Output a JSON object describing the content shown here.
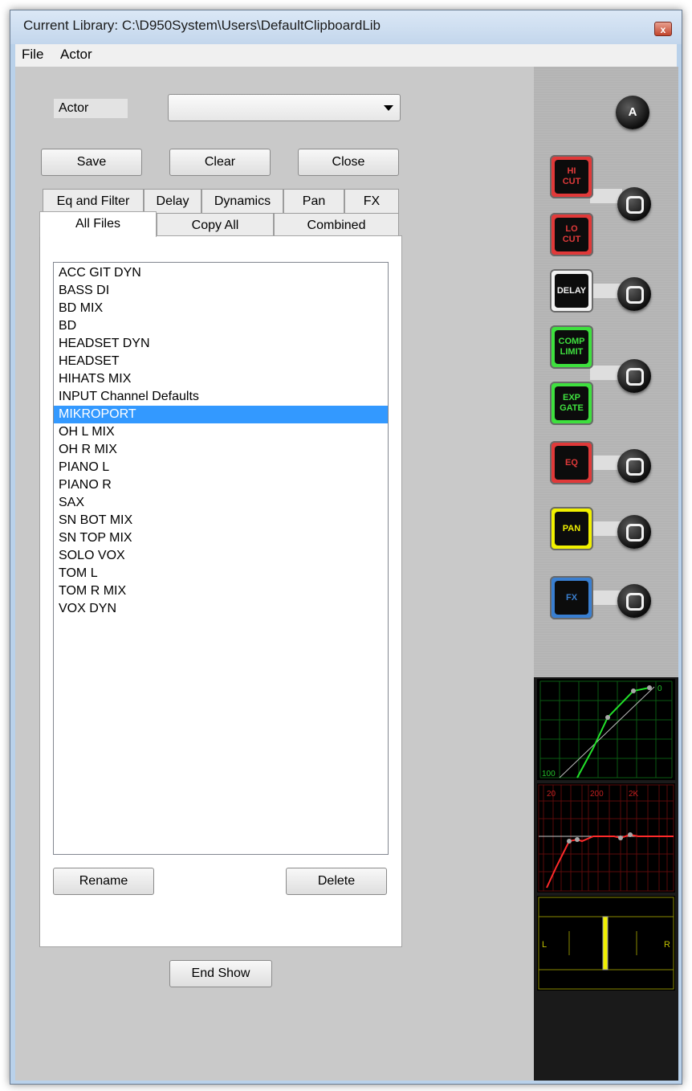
{
  "window": {
    "title": "Current Library: C:\\D950System\\Users\\DefaultClipboardLib",
    "close_glyph": "x"
  },
  "menu": [
    "File",
    "Actor"
  ],
  "actor": {
    "label": "Actor",
    "selected": ""
  },
  "buttons": {
    "save": "Save",
    "clear": "Clear",
    "close": "Close",
    "rename": "Rename",
    "delete": "Delete",
    "end_show": "End Show"
  },
  "tabs": {
    "top": [
      "Eq and Filter",
      "Delay",
      "Dynamics",
      "Pan",
      "FX"
    ],
    "bottom": [
      "All Files",
      "Copy All",
      "Combined"
    ],
    "active": "All Files"
  },
  "files": [
    "ACC GIT DYN",
    "BASS DI",
    "BD MIX",
    "BD",
    "HEADSET DYN",
    "HEADSET",
    "HIHATS MIX",
    "INPUT Channel Defaults",
    "MIKROPORT",
    "OH L MIX",
    "OH R MIX",
    "PIANO L",
    "PIANO R",
    "SAX",
    "SN BOT MIX",
    "SN TOP MIX",
    "SOLO VOX",
    "TOM L",
    "TOM R MIX",
    "VOX DYN"
  ],
  "selected_file": "MIKROPORT",
  "side_panel": {
    "a_knob": "A",
    "pads": [
      {
        "label": "HI\nCUT",
        "color": "#e03a3a"
      },
      {
        "label": "LO\nCUT",
        "color": "#e03a3a"
      },
      {
        "label": "DELAY",
        "color": "#f2f2f2"
      },
      {
        "label": "COMP\nLIMIT",
        "color": "#3fe03f"
      },
      {
        "label": "EXP\nGATE",
        "color": "#3fe03f"
      },
      {
        "label": "EQ",
        "color": "#e03a3a"
      },
      {
        "label": "PAN",
        "color": "#f0f000"
      },
      {
        "label": "FX",
        "color": "#3a7fd0"
      }
    ],
    "dyn_scope_labels": [
      "0",
      "100"
    ],
    "eq_scope_labels": [
      "20",
      "200",
      "2K"
    ],
    "pan_scope_labels": [
      "L",
      "R"
    ]
  }
}
